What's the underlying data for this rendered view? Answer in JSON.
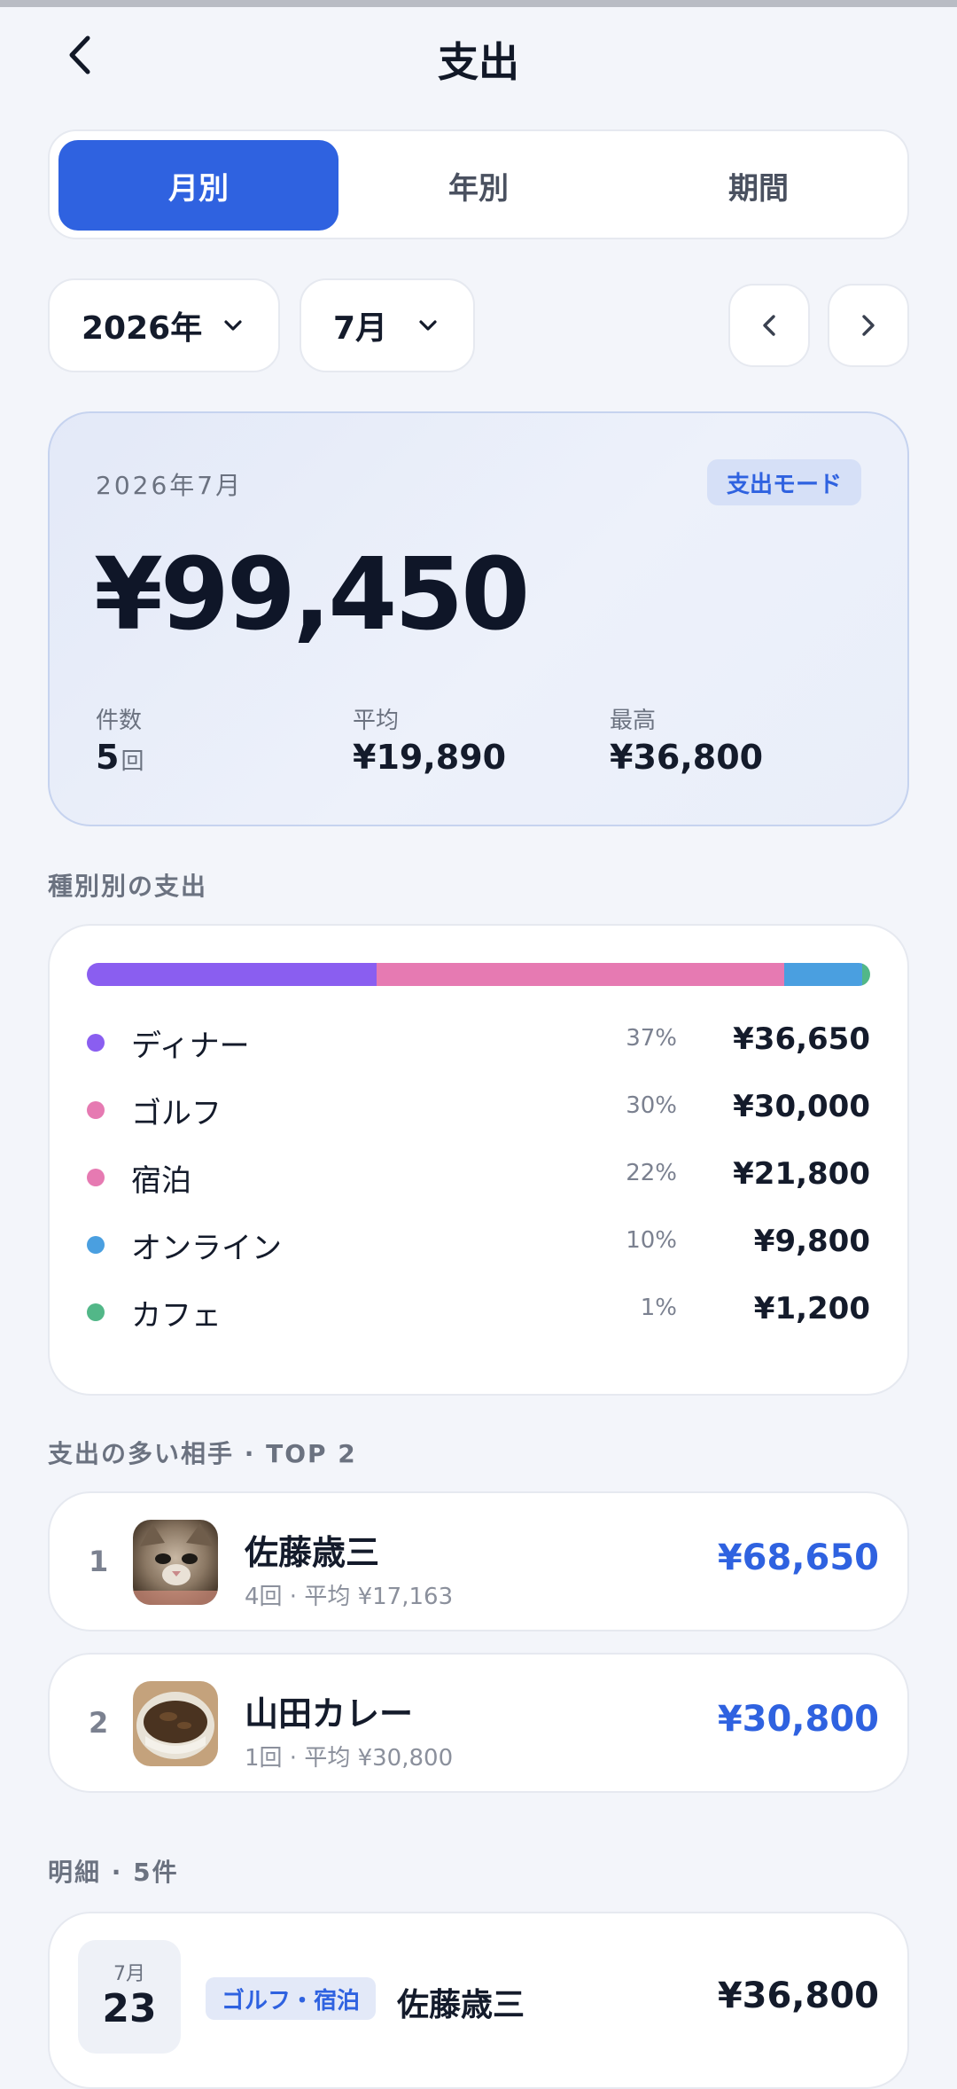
{
  "header": {
    "title": "支出",
    "back_icon": "chevron-left-icon"
  },
  "tabs": [
    {
      "label": "月別",
      "active": true
    },
    {
      "label": "年別",
      "active": false
    },
    {
      "label": "期間",
      "active": false
    }
  ],
  "filters": {
    "year": "2026年",
    "month": "7月"
  },
  "summary": {
    "period": "2026年7月",
    "mode_badge": "支出モード",
    "total": "¥99,450",
    "count_label": "件数",
    "count_value": "5",
    "count_unit": "回",
    "avg_label": "平均",
    "avg_value": "¥19,890",
    "max_label": "最高",
    "max_value": "¥36,800"
  },
  "breakdown": {
    "title": "種別別の支出",
    "items": [
      {
        "name": "ディナー",
        "pct": "37%",
        "amount": "¥36,650",
        "color": "#8a5ef0",
        "share": 0.37
      },
      {
        "name": "ゴルフ",
        "pct": "30%",
        "amount": "¥30,000",
        "color": "#e67ab2",
        "share": 0.3
      },
      {
        "name": "宿泊",
        "pct": "22%",
        "amount": "¥21,800",
        "color": "#e67ab2",
        "share": 0.22
      },
      {
        "name": "オンライン",
        "pct": "10%",
        "amount": "¥9,800",
        "color": "#4a9fe0",
        "share": 0.1
      },
      {
        "name": "カフェ",
        "pct": "1%",
        "amount": "¥1,200",
        "color": "#52b788",
        "share": 0.01
      }
    ]
  },
  "top": {
    "title": "支出の多い相手 · TOP 2",
    "items": [
      {
        "rank": "1",
        "name": "佐藤歳三",
        "sub": "4回 · 平均 ¥17,163",
        "amount": "¥68,650"
      },
      {
        "rank": "2",
        "name": "山田カレー",
        "sub": "1回 · 平均 ¥30,800",
        "amount": "¥30,800"
      }
    ]
  },
  "details": {
    "title": "明細 · 5件",
    "items": [
      {
        "month": "7月",
        "day": "23",
        "tag": "ゴルフ・宿泊",
        "name": "佐藤歳三",
        "amount": "¥36,800"
      }
    ]
  },
  "colors": {
    "accent": "#2f62e0"
  }
}
